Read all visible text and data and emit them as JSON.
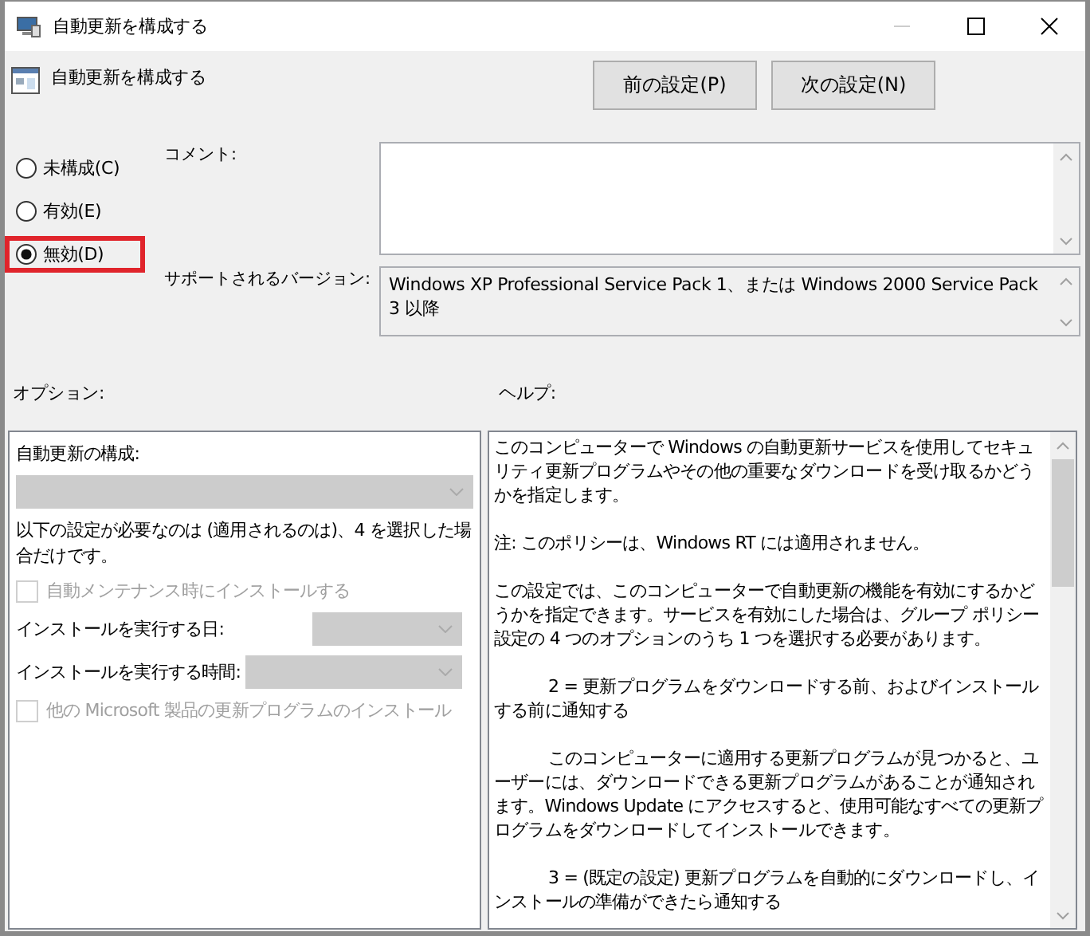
{
  "window": {
    "title": "自動更新を構成する"
  },
  "header": {
    "policy_name": "自動更新を構成する",
    "buttons": [
      {
        "label": "前の設定(P)"
      },
      {
        "label": "次の設定(N)"
      }
    ]
  },
  "state_options": [
    {
      "label": "未構成(C)",
      "selected": false,
      "highlighted": false
    },
    {
      "label": "有効(E)",
      "selected": false,
      "highlighted": false
    },
    {
      "label": "無効(D)",
      "selected": true,
      "highlighted": true
    }
  ],
  "comment": {
    "label": "コメント:"
  },
  "supported_on": {
    "label": "サポートされるバージョン:",
    "value": "Windows XP Professional Service Pack 1、または Windows 2000 Service Pack 3 以降"
  },
  "options": {
    "label": "オプション:",
    "items": [
      {
        "kind": "heading",
        "label": "自動更新の構成:"
      },
      {
        "kind": "dropdown",
        "disabled": true
      },
      {
        "kind": "note",
        "label": "以下の設定が必要なのは (適用されるのは)、4 を選択した場合だけです。"
      },
      {
        "kind": "checkbox",
        "label": "自動メンテナンス時にインストールする",
        "checked": false,
        "disabled": true
      },
      {
        "kind": "labeled_dropdown",
        "label": "インストールを実行する日:",
        "disabled": true
      },
      {
        "kind": "labeled_dropdown",
        "label": "インストールを実行する時間:",
        "disabled": true
      },
      {
        "kind": "checkbox",
        "label": "他の Microsoft 製品の更新プログラムのインストール",
        "checked": false,
        "disabled": true
      }
    ]
  },
  "help": {
    "label": "ヘルプ:",
    "paragraphs": [
      {
        "text": "このコンピューターで Windows の自動更新サービスを使用してセキュリティ更新プログラムやその他の重要なダウンロードを受け取るかどうかを指定します。",
        "indent": false
      },
      {
        "text": "注: このポリシーは、Windows RT には適用されません。",
        "indent": false
      },
      {
        "text": "この設定では、このコンピューターで自動更新の機能を有効にするかどうかを指定できます。サービスを有効にした場合は、グループ ポリシー設定の 4 つのオプションのうち 1 つを選択する必要があります。",
        "indent": false
      },
      {
        "text": "2 = 更新プログラムをダウンロードする前、およびインストールする前に通知する",
        "indent": true
      },
      {
        "text": "このコンピューターに適用する更新プログラムが見つかると、ユーザーには、ダウンロードできる更新プログラムがあることが通知されます。Windows Update にアクセスすると、使用可能なすべての更新プログラムをダウンロードしてインストールできます。",
        "indent": true
      },
      {
        "text": "3 = (既定の設定) 更新プログラムを自動的にダウンロードし、インストールの準備ができたら通知する",
        "indent": true
      }
    ]
  }
}
